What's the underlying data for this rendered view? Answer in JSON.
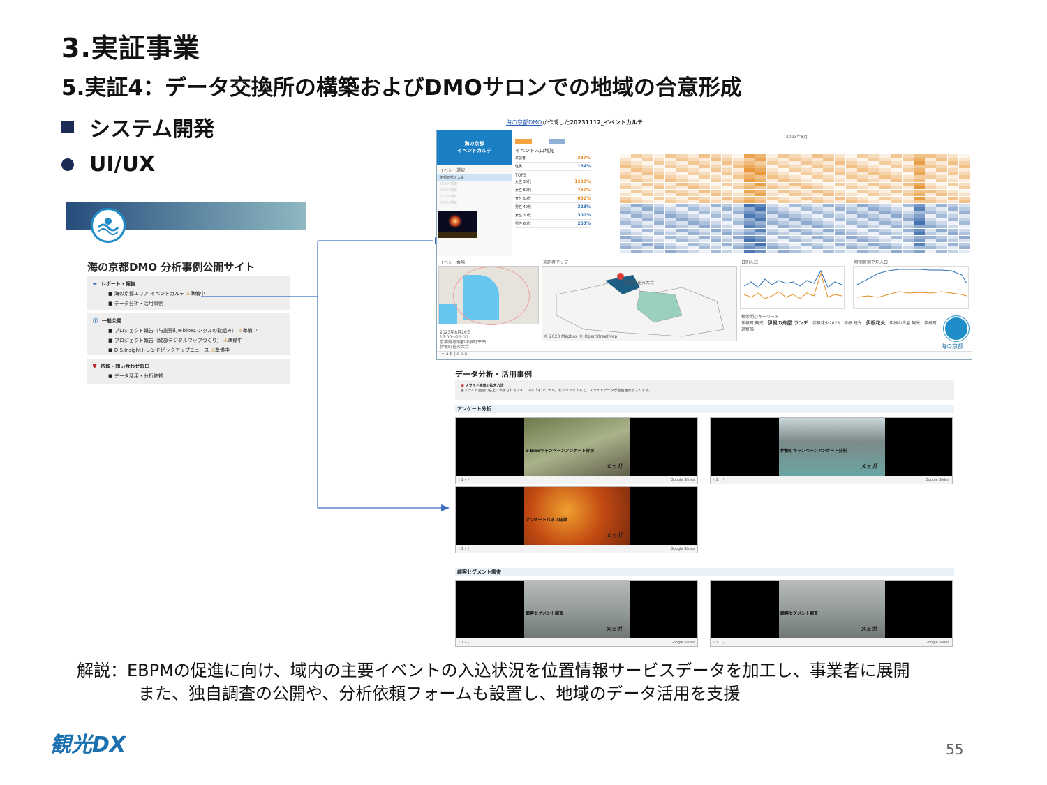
{
  "title": "3.実証事業",
  "subtitle": "5.実証4：データ交換所の構築およびDMOサロンでの地域の合意形成",
  "bullets": {
    "system": "システム開発",
    "uiux": "UI/UX"
  },
  "site": {
    "title": "海の京都DMO 分析事例公開サイト",
    "groups": [
      {
        "header": "レポート・報告",
        "items": [
          {
            "label": "海の京都エリア イベントカルテ",
            "status": "準備中"
          },
          {
            "label": "データ分析・活用事例",
            "status": ""
          }
        ]
      },
      {
        "header": "一般公開",
        "items": [
          {
            "label": "プロジェクト報告（与謝野町e-bikeレンタルの取組み）",
            "status": "準備中"
          },
          {
            "label": "プロジェクト報告（綾部デジタルマップづくり）",
            "status": "準備中"
          },
          {
            "label": "D.S.Insightトレンドピックアップニュース",
            "status": "準備中"
          }
        ]
      },
      {
        "header": "依頼・問い合わせ窓口",
        "items": [
          {
            "label": "データ活用・分析依頼",
            "status": ""
          }
        ]
      }
    ]
  },
  "tableau": {
    "title_link": "海の京都DMO",
    "title_mid": "が作成した",
    "title_bold": "20231112_イベントカルテ",
    "side_head": "海の京都\nイベントカルテ",
    "side_label": "イベント選択",
    "side_items": [
      "伊根町花火大会",
      "リスト項目",
      "リスト項目",
      "リスト項目",
      "リスト項目"
    ],
    "kpi_title": "イベント人口増加",
    "kpi_rows": [
      {
        "label": "来訪者",
        "value": "337%"
      },
      {
        "label": "住民",
        "value": "184%"
      }
    ],
    "top5_label": "TOP5",
    "top5": [
      {
        "label": "女性 30代",
        "value": "1200%"
      },
      {
        "label": "女性 60代",
        "value": "750%"
      },
      {
        "label": "女性 50代",
        "value": "682%"
      },
      {
        "label": "男性 40代",
        "value": "323%"
      },
      {
        "label": "女性 30代",
        "value": "300%"
      },
      {
        "label": "男性 60代",
        "value": "253%"
      }
    ],
    "month_label": "2023年8月",
    "map1_label": "イベント会場",
    "map2_label": "来訪者マップ",
    "map2_event": "伊根町花火大会",
    "chart1_label": "日別人口",
    "chart2_label": "時間帯別平均人口",
    "keywords_label": "検索関心キーワード",
    "keywords": [
      "伊根町 観光",
      "伊根の舟屋 ランチ",
      "伊根花火2023",
      "伊根 観光",
      "伊根花火",
      "伊根の舟屋 観光",
      "伊根町 遊覧船"
    ],
    "event_info": "2023年8月26日\n17:00～21:00\n京都府与謝郡伊根町平田\n伊根町花火大会",
    "map_credit": "© 2023 Mapbox © OpenStreetMap",
    "brand": "海の京都",
    "footer": "+ a b | e a u"
  },
  "analysis": {
    "heading": "データ分析・活用事例",
    "note_title": "スライド画面の拡大方法",
    "note_body": "各スライド画面の右上に表示されるアイコンの「オリジナル」をクリックすると、スライドデータが全画面表示されます。",
    "section1": "アンケート分析",
    "section2": "顧客セグメント調査",
    "slides": [
      {
        "caption": "e-bikeキャンペーンアンケート分析",
        "page": "1",
        "provider": "Google Slides"
      },
      {
        "caption": "伊根町キャンペーンアンケート分析",
        "page": "1",
        "provider": "Google Slides"
      },
      {
        "caption": "アンケートパネル結果",
        "page": "1",
        "provider": "Google Slides"
      },
      {
        "caption": "顧客セグメント調査",
        "page": "1",
        "provider": "Google Slides"
      },
      {
        "caption": "顧客セグメント調査",
        "page": "1",
        "provider": "Google Slides"
      }
    ],
    "slide_mark": "メェガ"
  },
  "explanation": {
    "label": "解説：",
    "line1": "EBPMの促進に向け、域内の主要イベントの入込状況を位置情報サービスデータを加工し、事業者に展開",
    "line2": "また、独自調査の公開や、分析依頼フォームも設置し、地域のデータ活用を支援"
  },
  "footer": {
    "logo": "観光DX",
    "page": "55"
  },
  "colors": {
    "navy": "#1c2b56",
    "tableau_blue": "#1a7fc4",
    "heat_orange": "#e58a1f",
    "heat_blue": "#2a5fa5"
  }
}
